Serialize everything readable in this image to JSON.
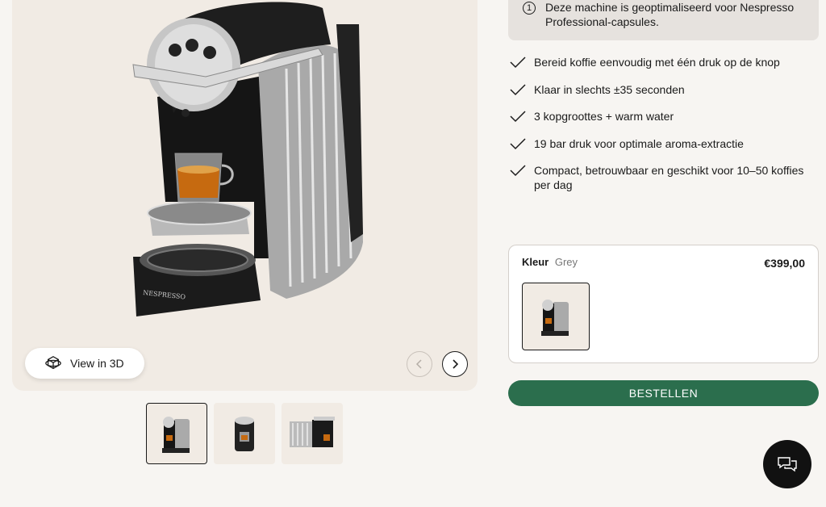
{
  "gallery": {
    "view_3d_label": "View in 3D",
    "brand_mark": "NESPRESSO",
    "thumbnails": [
      "thumb-1",
      "thumb-2",
      "thumb-3"
    ]
  },
  "info": {
    "number": "1",
    "text": "Deze machine is geoptimaliseerd voor Nespresso Professional-capsules."
  },
  "features": [
    "Bereid koffie eenvoudig met één druk op de knop",
    "Klaar in slechts ±35 seconden",
    "3 kopgroottes + warm water",
    "19 bar druk voor optimale aroma-extractie",
    "Compact, betrouwbaar en geschikt voor 10–50 koffies per dag"
  ],
  "variant": {
    "label": "Kleur",
    "value": "Grey",
    "price": "€399,00"
  },
  "order_label": "BESTELLEN",
  "colors": {
    "accent": "#2b6e4d",
    "background": "#f1ebe4"
  },
  "icons": {
    "view3d": "3d-cube-icon",
    "prev": "chevron-left-icon",
    "next": "chevron-right-icon",
    "check": "checkmark-icon",
    "info": "info-number-icon",
    "chat": "chat-bubbles-icon"
  }
}
